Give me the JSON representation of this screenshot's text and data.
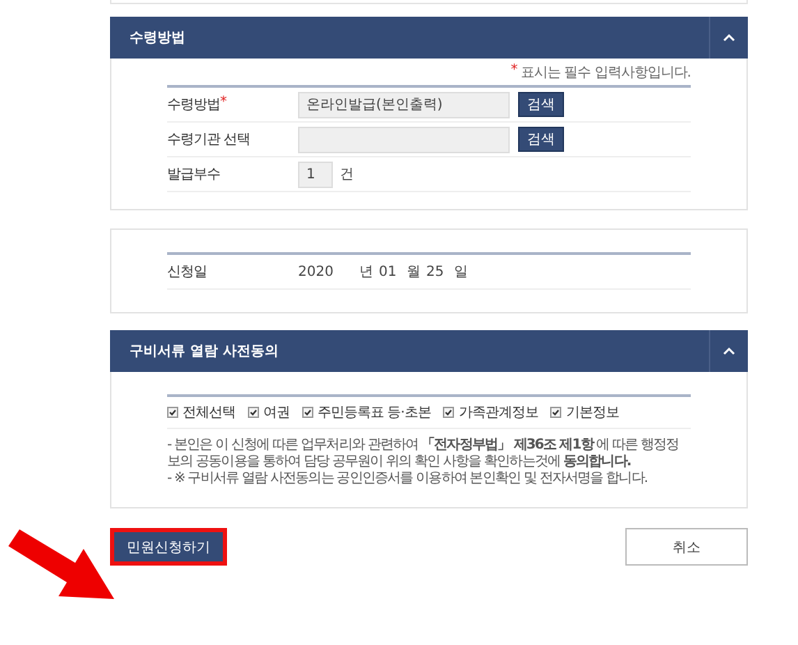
{
  "receipt_section": {
    "title": "수령방법",
    "expanded": true,
    "required_mark": "*",
    "required_note": "표시는 필수 입력사항입니다.",
    "rows": [
      {
        "kind": "search",
        "label": "수령방법",
        "required": true,
        "value": "온라인발급(본인출력)",
        "button": "검색"
      },
      {
        "kind": "search",
        "label": "수령기관 선택",
        "required": false,
        "value": "",
        "button": "검색"
      },
      {
        "kind": "count",
        "label": "발급부수",
        "required": false,
        "value": "1",
        "unit": "건"
      }
    ]
  },
  "date_section": {
    "label": "신청일",
    "parts": [
      {
        "value": "2020",
        "unit": "년"
      },
      {
        "value": "01",
        "unit": "월"
      },
      {
        "value": "25",
        "unit": "일"
      }
    ]
  },
  "consent_section": {
    "title": "구비서류 열람 사전동의",
    "expanded": true,
    "checkboxes": [
      {
        "label": "전체선택",
        "checked": true
      },
      {
        "label": "여권",
        "checked": true
      },
      {
        "label": "주민등록표 등·초본",
        "checked": true
      },
      {
        "label": "가족관계정보",
        "checked": true
      },
      {
        "label": "기본정보",
        "checked": true
      }
    ],
    "notes": [
      "- 본인은 이 신청에 따른 업무처리와 관련하여 **「전자정부법」 제36조 제1항** 에 따른 행정정보의 공동이용을 통하여 담당 공무원이 위의 확인 사항을 확인하는것에 **동의합니다.**",
      "- ※ 구비서류 열람 사전동의는 공인인증서를 이용하여 본인확인 및 전자서명을 합니다."
    ]
  },
  "buttons": [
    {
      "kind": "primary",
      "label": "민원신청하기",
      "highlighted": true
    },
    {
      "kind": "secondary",
      "label": "취소",
      "highlighted": false
    }
  ]
}
